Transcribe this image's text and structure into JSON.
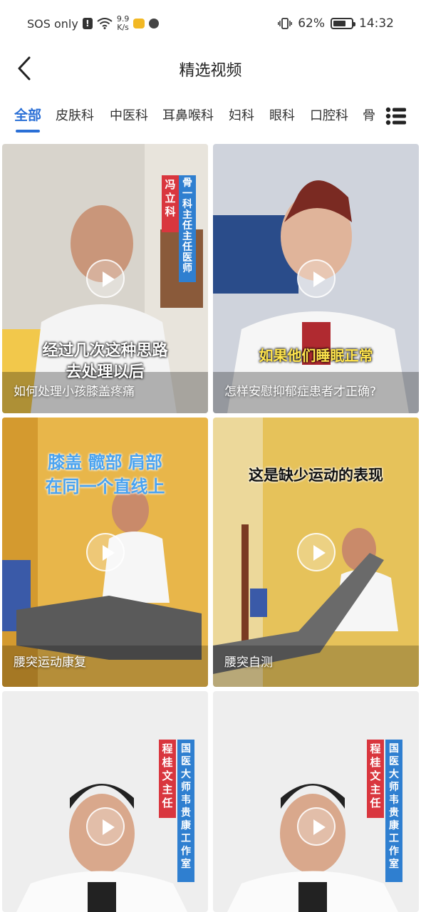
{
  "status_bar": {
    "network": "SOS only",
    "speed_value": "9.9",
    "speed_unit": "K/s",
    "battery": "62%",
    "time": "14:32"
  },
  "header": {
    "title": "精选视频"
  },
  "tabs": [
    "全部",
    "皮肤科",
    "中医科",
    "耳鼻喉科",
    "妇科",
    "眼科",
    "口腔科",
    "骨"
  ],
  "active_tab": 0,
  "videos": [
    {
      "caption": "如何处理小孩膝盖疼痛",
      "overlay": "经过几次这种思路\n去处理以后",
      "label_red": "冯立科",
      "label_blue": "骨一科主任 主任医师"
    },
    {
      "caption": "怎样安慰抑郁症患者才正确?",
      "overlay": "如果他们睡眠正常"
    },
    {
      "caption": "腰突运动康复",
      "overlay": "膝盖 髋部 肩部\n在同一个直线上"
    },
    {
      "caption": "腰突自测",
      "overlay": "这是缺少运动的表现"
    },
    {
      "label_red": "程桂文主任",
      "label_blue": "国医大师韦贵康工作室"
    },
    {
      "label_red": "程桂文主任",
      "label_blue": "国医大师韦贵康工作室"
    }
  ],
  "colors": {
    "accent": "#2a6fd6",
    "label_red": "#d9363e",
    "label_blue": "#2f7fd0",
    "overlay_yellow": "#ffe44d",
    "overlay_blue": "#4aa3f0"
  }
}
